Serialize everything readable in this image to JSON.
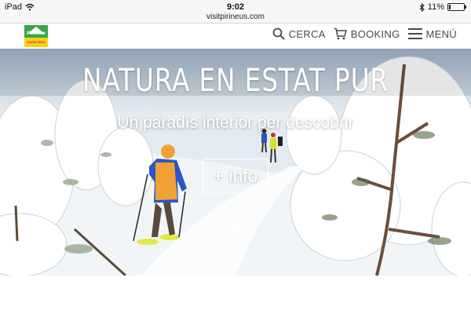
{
  "status_bar": {
    "device": "iPad",
    "time": "9:02",
    "url": "visitpirineus.com",
    "battery": "11%"
  },
  "logo": {
    "name": "Pirineus",
    "subtitle": "CATALUNYA"
  },
  "nav": {
    "search_label": "CERCA",
    "booking_label": "BOOKING",
    "menu_label": "MENÚ"
  },
  "hero": {
    "title": "NATURA EN ESTAT PUR",
    "subtitle": "Un paradís interior per descobrir",
    "info_button": "+ info"
  },
  "colors": {
    "logo_green": "#3aa64a",
    "logo_yellow": "#f5d11a",
    "nav_text": "#4a4a4a",
    "jacket_orange": "#f0a133",
    "jacket_blue": "#2b55c9"
  },
  "icons": {
    "search": "search-icon",
    "booking": "cart-icon",
    "menu": "hamburger-icon",
    "prev": "chevron-left-icon",
    "next": "chevron-right-icon",
    "scroll": "arrow-down-icon"
  }
}
